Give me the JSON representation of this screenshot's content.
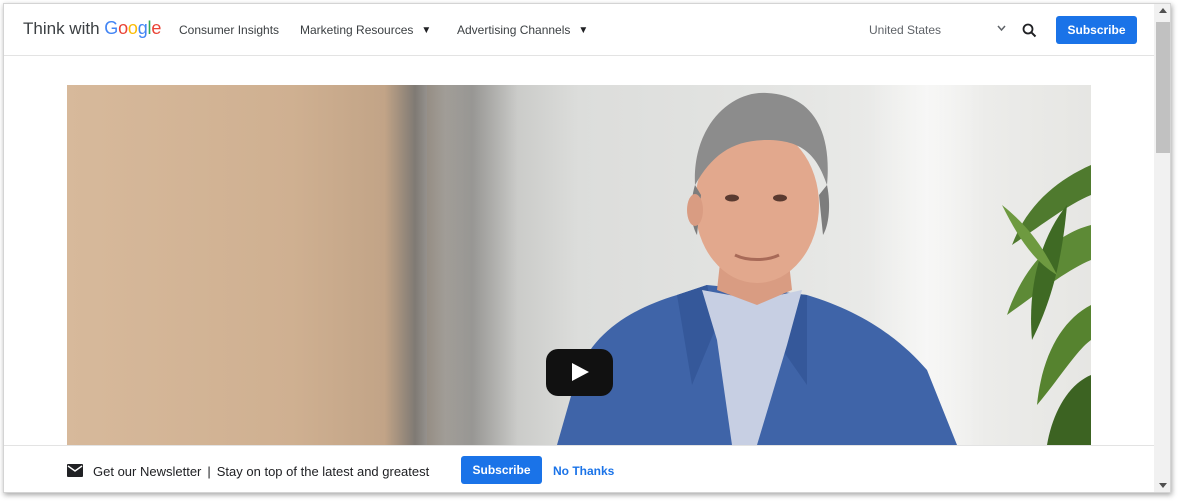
{
  "header": {
    "logo_prefix": "Think with ",
    "logo_brand": "Google",
    "brand_colors": [
      "#4285F4",
      "#EA4335",
      "#FBBC05",
      "#4285F4",
      "#34A853",
      "#EA4335"
    ],
    "nav": [
      {
        "label": "Consumer Insights",
        "has_dropdown": false
      },
      {
        "label": "Marketing Resources",
        "has_dropdown": true
      },
      {
        "label": "Advertising Channels",
        "has_dropdown": true
      }
    ],
    "country": "United States",
    "subscribe_label": "Subscribe"
  },
  "video": {
    "play_icon": "play-icon"
  },
  "newsletter": {
    "title": "Get our Newsletter",
    "separator": "|",
    "tagline": "Stay on top of the latest and greatest",
    "subscribe_label": "Subscribe",
    "dismiss_label": "No Thanks"
  },
  "colors": {
    "accent": "#1a73e8",
    "text": "#3c4043"
  }
}
